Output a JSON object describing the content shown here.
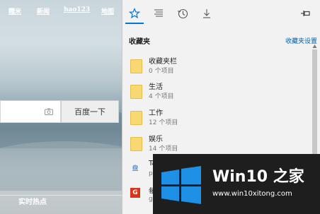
{
  "browser": {
    "topnav": [
      "糯米",
      "新闻",
      "hao123",
      "地图"
    ],
    "search_button": "百度一下",
    "hot_label": "实时热点"
  },
  "panel": {
    "title": "收藏夹",
    "settings_link": "收藏夹设置",
    "tabs": [
      "favorites-icon",
      "reading-list-icon",
      "history-icon",
      "downloads-icon"
    ],
    "items": [
      {
        "name": "收藏夹栏",
        "count": "0 个项目"
      },
      {
        "name": "生活",
        "count": "4 个项目"
      },
      {
        "name": "工作",
        "count": "12 个项目"
      },
      {
        "name": "娱乐",
        "count": "14 个项目"
      }
    ],
    "sites": [
      {
        "name": "Ta",
        "sub": "pa",
        "icon": "盘"
      },
      {
        "name": "每",
        "sub": "ga",
        "icon": "G"
      }
    ]
  },
  "watermark": {
    "title": "Win10 之家",
    "url": "www.win10xitong.com"
  }
}
